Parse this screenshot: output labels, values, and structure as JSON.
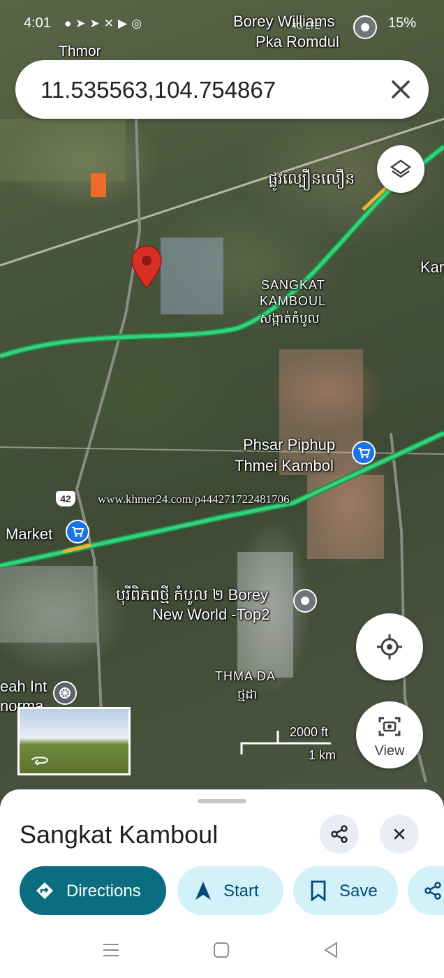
{
  "status_bar": {
    "time": "4:01",
    "battery": "15%",
    "network": "4G LTE",
    "notification_icons": [
      "wechat-icon",
      "telegram-icon",
      "telegram-icon",
      "x-icon",
      "youtube-icon",
      "location-icon"
    ]
  },
  "search": {
    "query": "11.535563,104.754867"
  },
  "map": {
    "labels": {
      "thmor": "Thmor",
      "borey_williams": "Borey Williams",
      "pka_romdul": "Pka Romdul",
      "khmer_road": "ផ្លូវល្បឿនលឿន",
      "sangkat_kamboul_1": "SANGKAT",
      "sangkat_kamboul_2": "KAMBOUL",
      "sangkat_kamboul_km": "សង្កាត់កំបូល",
      "ka_partial": "Kar",
      "phsar_1": "Phsar Piphup",
      "phsar_2": "Thmei Kambol",
      "route_42": "42",
      "market": "Market",
      "watermark": "www.khmer24.com/p444271722481706",
      "borey_new_world_1": "បុរីពិភពថ្មី កំបូល ២ Borey",
      "borey_new_world_2": "New World -Top2",
      "thma_da": "THMA DA",
      "thma_da_km": "ថ្មដា",
      "eah_int_1": "eah Int",
      "eah_int_2": "norma",
      "scale_ft": "2000 ft",
      "scale_km": "1 km"
    },
    "view_button": "View"
  },
  "place_sheet": {
    "title": "Sangkat Kamboul",
    "actions": {
      "directions": "Directions",
      "start": "Start",
      "save": "Save"
    }
  },
  "colors": {
    "accent": "#0a6e80",
    "chip_bg": "#d3f1f8",
    "pin": "#d93025",
    "poi": "#1a73e8",
    "highway": "#2ecc71"
  }
}
